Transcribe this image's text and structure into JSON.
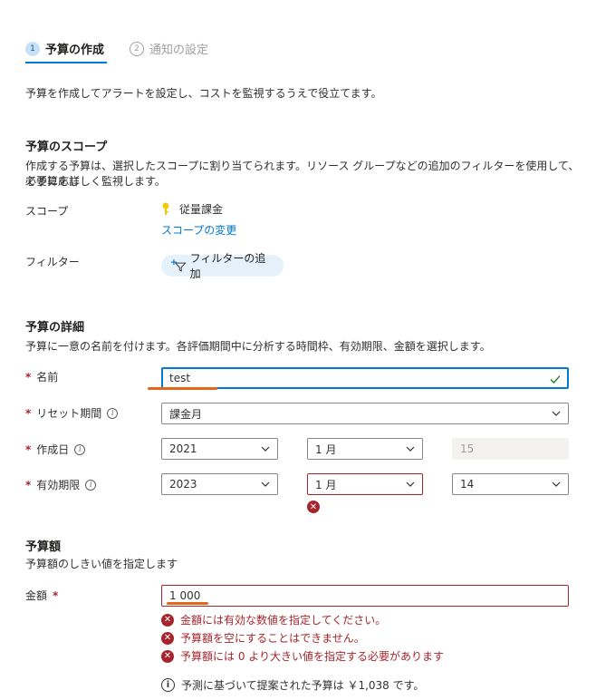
{
  "steps": [
    {
      "number": "1",
      "label": "予算の作成"
    },
    {
      "number": "2",
      "label": "通知の設定"
    }
  ],
  "intro": "予算を作成してアラートを設定し、コストを監視するうえで役立てます。",
  "scope": {
    "title": "予算のスコープ",
    "desc_line1": "作成する予算は、選択したスコープに割り当てられます。リソース グループなどの追加のフィルターを使用して、必要に応じ",
    "desc_line2": "て予算を詳しく監視します。",
    "scope_label": "スコープ",
    "scope_value": "従量課金",
    "change_link": "スコープの変更",
    "filter_label": "フィルター",
    "add_filter_button": "フィルターの追加"
  },
  "details": {
    "title": "予算の詳細",
    "desc": "予算に一意の名前を付けます。各評価期間中に分析する時間枠、有効期限、金額を選択します。",
    "name_label": "名前",
    "name_value": "test",
    "reset_label": "リセット期間",
    "reset_value": "課金月",
    "created_label": "作成日",
    "created_year": "2021",
    "created_month": "1 月",
    "created_day": "15",
    "expire_label": "有効期限",
    "expire_year": "2023",
    "expire_month": "1 月",
    "expire_day": "14",
    "required_mark": "*"
  },
  "amount": {
    "title": "予算額",
    "desc": "予算額のしきい値を指定します",
    "label": "金額",
    "value": "1 000",
    "errors": [
      "金額には有効な数値を指定してください。",
      "予算額を空にすることはできません。",
      "予算額には 0 より大きい値を指定する必要があります"
    ],
    "suggestion": "予測に基づいて提案された予算は ￥1,038 です。"
  },
  "colors": {
    "accent": "#0078d4",
    "error": "#a4262c",
    "highlight": "#e3661b"
  }
}
